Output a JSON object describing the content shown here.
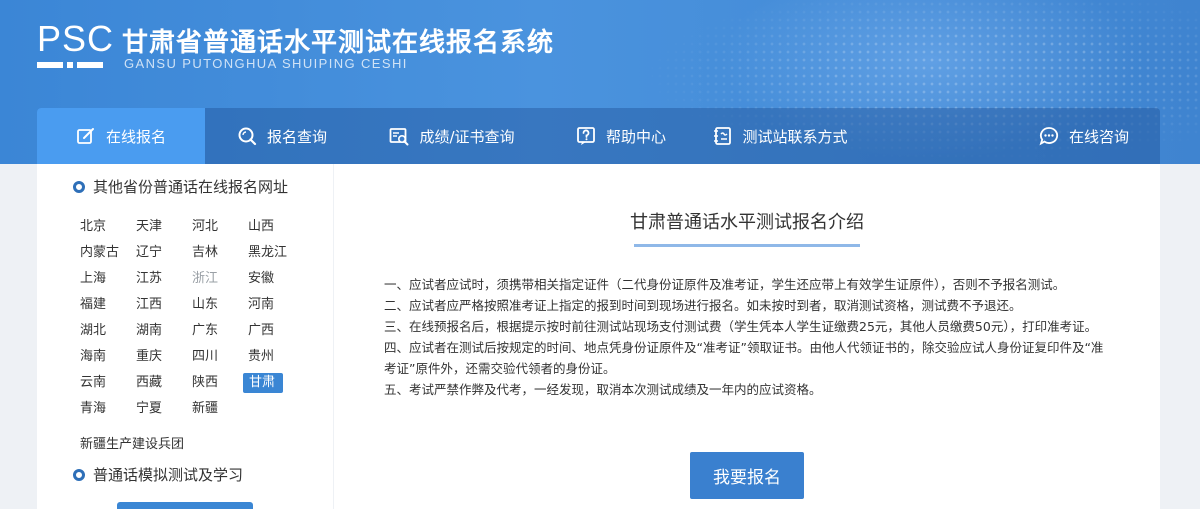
{
  "header": {
    "logo_text": "PSC",
    "title": "甘肃省普通话水平测试在线报名系统",
    "subtitle": "GANSU PUTONGHUA SHUIPING CESHI"
  },
  "nav": {
    "items": [
      {
        "label": "在线报名",
        "icon": "edit-icon",
        "active": true
      },
      {
        "label": "报名查询",
        "icon": "search-icon",
        "active": false
      },
      {
        "label": "成绩/证书查询",
        "icon": "certificate-search-icon",
        "active": false
      },
      {
        "label": "帮助中心",
        "icon": "help-icon",
        "active": false
      },
      {
        "label": "测试站联系方式",
        "icon": "contact-icon",
        "active": false
      },
      {
        "label": "在线咨询",
        "icon": "chat-icon",
        "active": false
      }
    ]
  },
  "sidebar": {
    "other_provinces_heading": "其他省份普通话在线报名网址",
    "provinces": [
      [
        "北京",
        "天津",
        "河北",
        "山西"
      ],
      [
        "内蒙古",
        "辽宁",
        "吉林",
        "黑龙江"
      ],
      [
        "上海",
        "江苏",
        "浙江",
        "安徽"
      ],
      [
        "福建",
        "江西",
        "山东",
        "河南"
      ],
      [
        "湖北",
        "湖南",
        "广东",
        "广西"
      ],
      [
        "海南",
        "重庆",
        "四川",
        "贵州"
      ],
      [
        "云南",
        "西藏",
        "陕西",
        "甘肃"
      ],
      [
        "青海",
        "宁夏",
        "新疆"
      ]
    ],
    "muted_province": "浙江",
    "active_province": "甘肃",
    "bingtuan": "新疆生产建设兵团",
    "practice_heading": "普通话模拟测试及学习"
  },
  "main": {
    "title": "甘肃普通话水平测试报名介绍",
    "rules": [
      "一、应试者应试时，须携带相关指定证件（二代身份证原件及准考证，学生还应带上有效学生证原件），否则不予报名测试。",
      "二、应试者应严格按照准考证上指定的报到时间到现场进行报名。如未按时到者，取消测试资格，测试费不予退还。",
      "三、在线预报名后，根据提示按时前往测试站现场支付测试费（学生凭本人学生证缴费25元，其他人员缴费50元），打印准考证。",
      "四、应试者在测试后按规定的时间、地点凭身份证原件及“准考证”领取证书。由他人代领证书的，除交验应试人身份证复印件及“准考证”原件外，还需交验代领者的身份证。",
      "五、考试严禁作弊及代考，一经发现，取消本次测试成绩及一年内的应试资格。"
    ],
    "signup_button": "我要报名"
  },
  "colors": {
    "banner": "#3f8ad8",
    "nav_active": "#4a9cf0",
    "accent": "#3a80cf",
    "title_underline": "#8fb8e8"
  }
}
